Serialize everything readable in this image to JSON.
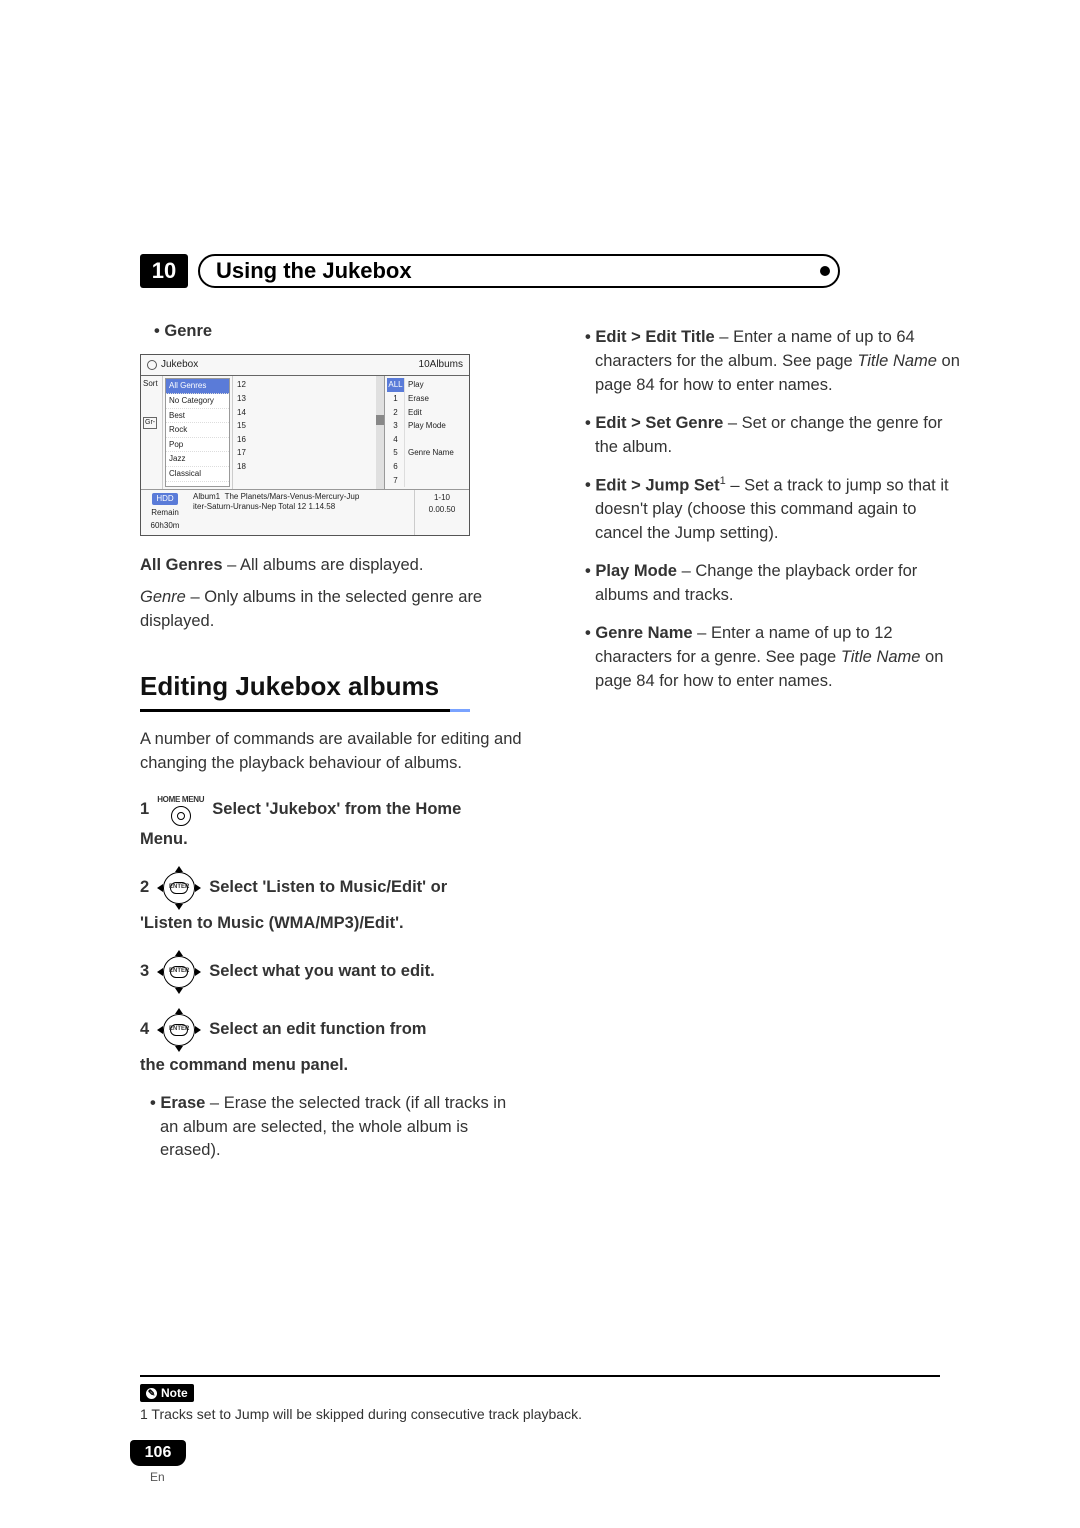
{
  "chapter": {
    "number": "10",
    "title": "Using the Jukebox"
  },
  "left": {
    "genre_label": "Genre",
    "screenshot": {
      "title": "Jukebox",
      "album_count": "10Albums",
      "sort_label": "Sort",
      "group_prefix": "Gr-",
      "genres_header": "All Genres",
      "genres": [
        "No Category",
        "Best",
        "Rock",
        "Pop",
        "Jazz",
        "Classical"
      ],
      "album_prefixes": [
        "12",
        "13",
        "14",
        "15",
        "16",
        "17",
        "18"
      ],
      "cmd_header": "ALL",
      "nums": [
        "1",
        "2",
        "3",
        "4",
        "5",
        "6",
        "7"
      ],
      "cmds": [
        "Play",
        "Erase",
        "Edit",
        "Play Mode",
        "",
        "Genre Name",
        ""
      ],
      "hdd_label": "HDD",
      "remain_label": "Remain",
      "remain_value": "60h30m",
      "footer_album": "Album1",
      "footer_track": "The Planets/Mars-Venus-Mercury-Jup",
      "footer_total": "iter-Saturn-Uranus-Nep    Total 12   1.14.58",
      "footer_progress": "1-10",
      "footer_time": "0.00.50"
    },
    "caption_all_label": "All Genres",
    "caption_all_text": " – All albums are displayed.",
    "caption_genre_label": "Genre",
    "caption_genre_text": " – Only albums in the selected genre are displayed.",
    "section_title": "Editing Jukebox albums",
    "intro": "A number of commands are available for editing and changing the playback behaviour of albums.",
    "steps": {
      "s1_num": "1",
      "s1_btn": "HOME MENU",
      "s1_text": "Select 'Jukebox' from the Home",
      "s1_after": "Menu.",
      "s2_num": "2",
      "s2_text": "Select 'Listen to Music/Edit' or",
      "s2_after": "'Listen to Music (WMA/MP3)/Edit'.",
      "s3_num": "3",
      "s3_text": "Select what you want to edit.",
      "s4_num": "4",
      "s4_text": "Select an edit function from",
      "s4_after": "the command menu panel.",
      "enter": "ENTER"
    },
    "erase_label": "Erase",
    "erase_text": " – Erase the selected track (if all tracks in an album are selected, the whole album is erased)."
  },
  "right": {
    "items": [
      {
        "label": "Edit > Edit Title",
        "text": " – Enter a name of up to 64 characters for the album. See page ",
        "em": "Title Name",
        "tail": " on page 84 for how to enter names."
      },
      {
        "label": "Edit > Set Genre",
        "text": " – Set or change the genre for the album.",
        "em": "",
        "tail": ""
      },
      {
        "label": "Edit > Jump Set",
        "sup": "1",
        "text": " – Set a track to jump so that it doesn't play (choose this command again to cancel the Jump setting).",
        "em": "",
        "tail": ""
      },
      {
        "label": "Play Mode",
        "text": " – Change the playback order for albums and tracks.",
        "em": "",
        "tail": ""
      },
      {
        "label": "Genre Name",
        "text": " – Enter a name of up to 12 characters for a genre. See page ",
        "em": "Title Name",
        "tail": " on page 84 for how to enter names."
      }
    ]
  },
  "note": {
    "label": "Note",
    "text": "1 Tracks set to Jump will be skipped during consecutive track playback."
  },
  "footer": {
    "page": "106",
    "lang": "En"
  }
}
